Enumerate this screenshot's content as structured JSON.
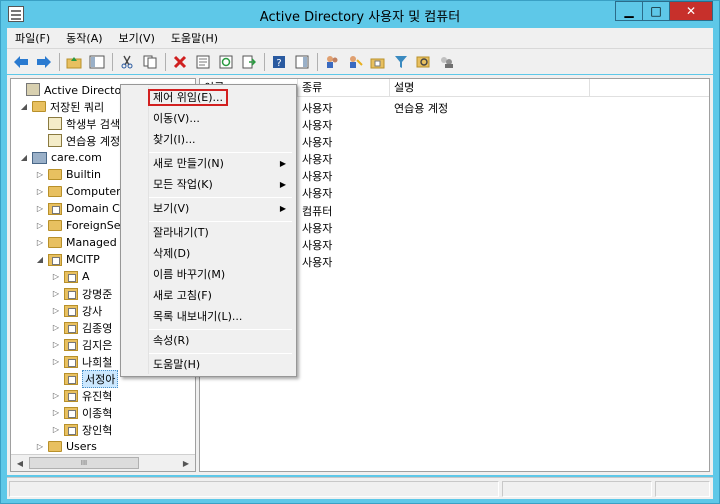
{
  "window": {
    "title": "Active Directory 사용자 및 컴퓨터",
    "minimize": "▁",
    "maximize": "□",
    "close": "✕"
  },
  "menubar": [
    "파일(F)",
    "동작(A)",
    "보기(V)",
    "도움말(H)"
  ],
  "toolbar": {
    "icons": [
      "back-arrow-icon",
      "forward-arrow-icon",
      "up-folder-icon",
      "show-hide-tree-icon",
      "cut-icon",
      "copy-icon",
      "delete-icon",
      "properties-icon",
      "refresh-icon",
      "export-list-icon",
      "help-icon",
      "action-pane-icon",
      "users-icon",
      "add-user-icon",
      "add-ou-icon",
      "filter-icon",
      "find-icon",
      "add-to-group-icon"
    ]
  },
  "tree": {
    "root": "Active Directory 사용자 및 컴퓨터",
    "saved_queries": "저장된 쿼리",
    "query_1": "학생부 검색",
    "query_2": "연습용 계정",
    "domain": "care.com",
    "builtin": "Builtin",
    "computers": "Computers",
    "domain_c": "Domain C",
    "foreign": "ForeignSec",
    "managed": "Managed S",
    "mcitp": "MCITP",
    "ou_a": "A",
    "ou_2": "강명준",
    "ou_3": "강사",
    "ou_4": "김종영",
    "ou_5": "김지은",
    "ou_6": "나희철",
    "ou_7": "서정아",
    "ou_8": "유진혁",
    "ou_9": "이종혁",
    "ou_10": "장인혁",
    "users": "Users"
  },
  "list": {
    "columns": [
      "이름",
      "종류",
      "설명"
    ],
    "rows": [
      {
        "type": "사용자",
        "desc": "연습용 계정"
      },
      {
        "type": "사용자",
        "desc": ""
      },
      {
        "type": "사용자",
        "desc": ""
      },
      {
        "type": "사용자",
        "desc": ""
      },
      {
        "type": "사용자",
        "desc": ""
      },
      {
        "type": "사용자",
        "desc": ""
      },
      {
        "type": "컴퓨터",
        "desc": ""
      },
      {
        "type": "사용자",
        "desc": ""
      },
      {
        "type": "사용자",
        "desc": ""
      },
      {
        "type": "사용자",
        "desc": ""
      }
    ]
  },
  "context_menu": {
    "delegate": "제어 위임(E)...",
    "move": "이동(V)...",
    "find": "찾기(I)...",
    "new": "새로 만들기(N)",
    "all_tasks": "모든 작업(K)",
    "view": "보기(V)",
    "cut": "잘라내기(T)",
    "delete": "삭제(D)",
    "rename": "이름 바꾸기(M)",
    "refresh": "새로 고침(F)",
    "export": "목록 내보내기(L)...",
    "properties": "속성(R)",
    "help": "도움말(H)",
    "submenu_arrow": "▶"
  },
  "scrollbar": {
    "left": "◀",
    "right": "▶",
    "thumb": "III"
  },
  "colors": {
    "title_bar": "#5ec8e8",
    "close_button": "#c7302b",
    "highlight_border": "#d22020"
  }
}
